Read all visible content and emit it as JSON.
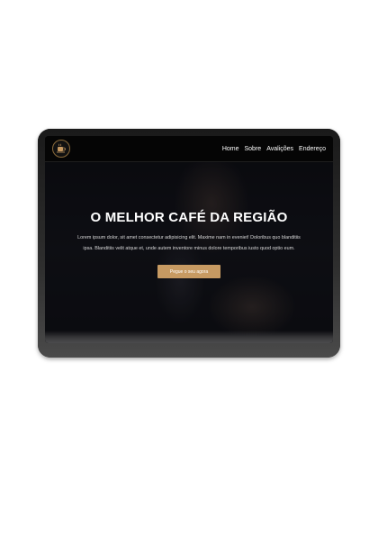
{
  "nav": {
    "logo_icon": "coffee-cup-icon",
    "links": [
      {
        "label": "Home"
      },
      {
        "label": "Sobre"
      },
      {
        "label": "Avalições"
      },
      {
        "label": "Endereço"
      }
    ]
  },
  "hero": {
    "title": "O MELHOR CAFÉ DA REGIÃO",
    "text_line1": "Lorem ipsum dolor, sit amet consectetur adipisicing elit. Maxime nam in eveniet! Doloribus quo blanditiis",
    "text_line2": "ipsa. Blanditiis velit atque et, unde autem inventore minus dolore temporibus iusto quod optio eum.",
    "cta_label": "Pegue o seu agora"
  },
  "colors": {
    "accent": "#c79a62",
    "navbar": "#050505",
    "hero_bg": "#0b0c10",
    "device_frame": "#2a2a2a"
  }
}
